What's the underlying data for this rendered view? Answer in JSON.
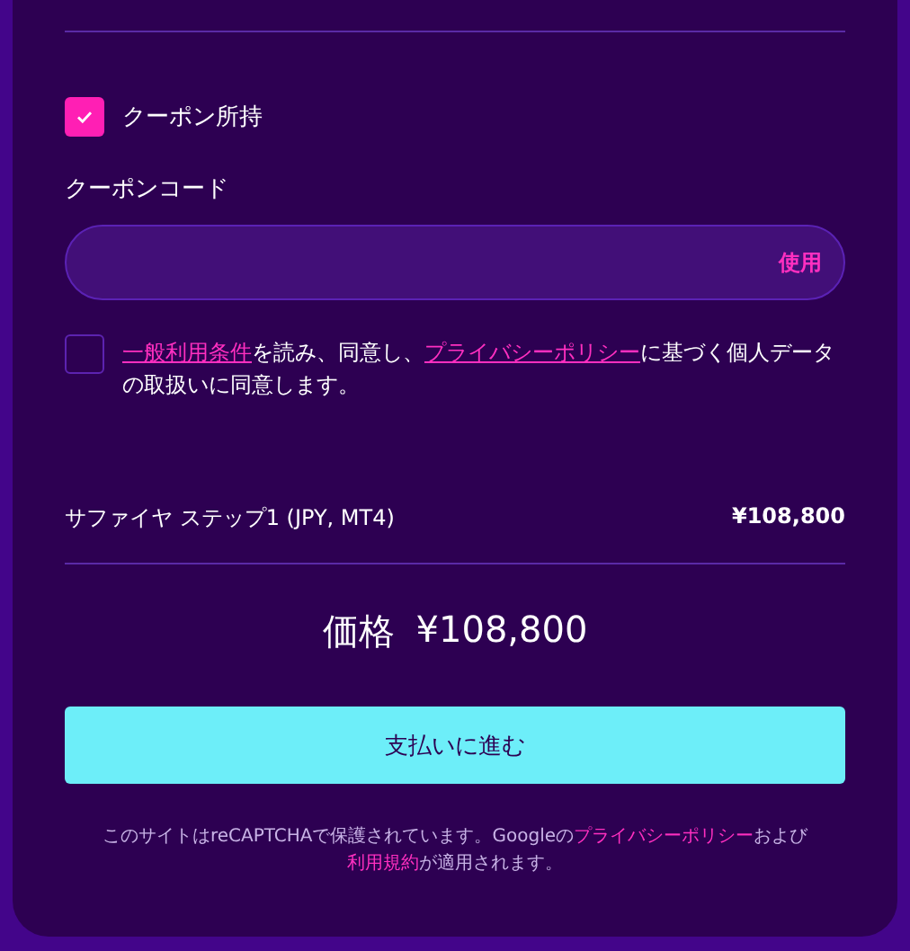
{
  "coupon_toggle": {
    "label": "クーポン所持",
    "checked": true
  },
  "coupon_code": {
    "label": "クーポンコード",
    "apply_button": "使用"
  },
  "consent": {
    "checked": false,
    "parts": [
      {
        "kind": "link",
        "text": "一般利用条件"
      },
      {
        "kind": "text",
        "text": "を読み、同意し、"
      },
      {
        "kind": "link",
        "text": "プライバシーポリシー"
      },
      {
        "kind": "text",
        "text": "に基づく個人データの取扱いに同意します。"
      }
    ]
  },
  "product": {
    "name": "サファイヤ ステップ1 (JPY, MT4)",
    "price": "¥108,800"
  },
  "total": {
    "label": "価格",
    "amount": "¥108,800"
  },
  "pay_button": "支払いに進む",
  "footer": {
    "parts": [
      {
        "kind": "text",
        "text": "このサイトはreCAPTCHAで保護されています。Googleの"
      },
      {
        "kind": "link",
        "text": "プライバシーポリシー"
      },
      {
        "kind": "text",
        "text": "および"
      },
      {
        "kind": "link",
        "text": "利用規約"
      },
      {
        "kind": "text",
        "text": "が適用されます。"
      }
    ]
  }
}
